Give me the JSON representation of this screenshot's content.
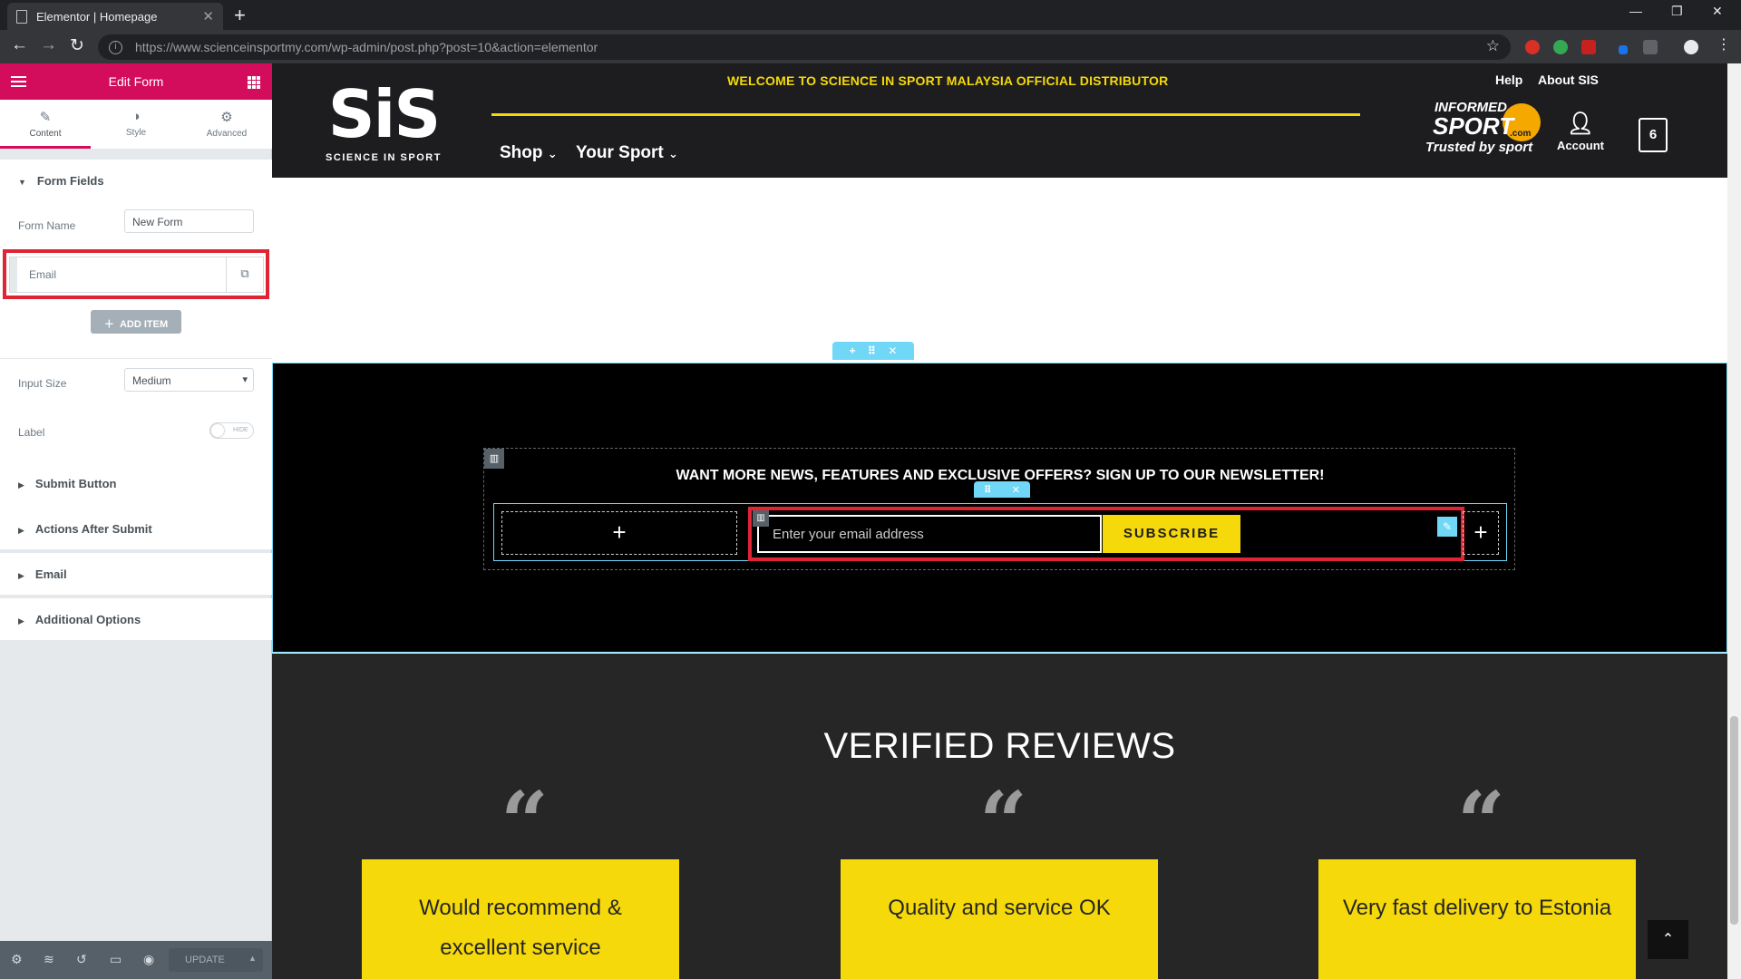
{
  "browser": {
    "tab_title": "Elementor | Homepage",
    "url": "https://www.scienceinsportmy.com/wp-admin/post.php?post=10&action=elementor"
  },
  "panel": {
    "header_title": "Edit Form",
    "tabs": [
      {
        "label": "Content",
        "icon": "pencil-icon"
      },
      {
        "label": "Style",
        "icon": "half-circle-icon"
      },
      {
        "label": "Advanced",
        "icon": "gear-icon"
      }
    ],
    "form_fields_title": "Form Fields",
    "form_name_label": "Form Name",
    "form_name_value": "New Form",
    "field_item_label": "Email",
    "add_item_label": "ADD ITEM",
    "input_size_label": "Input Size",
    "input_size_value": "Medium",
    "label_label": "Label",
    "label_toggle_text": "HIDE",
    "sections": [
      "Submit Button",
      "Actions After Submit",
      "Email",
      "Additional Options"
    ],
    "update_label": "UPDATE"
  },
  "site": {
    "welcome_text": "WELCOME TO SCIENCE IN SPORT MALAYSIA OFFICIAL DISTRIBUTOR",
    "help_link": "Help",
    "about_link": "About SIS",
    "logo_big": "SiS",
    "logo_small": "SCIENCE IN SPORT",
    "menu": [
      "Shop",
      "Your Sport"
    ],
    "informed_a": "INFORMED",
    "informed_b": "SPORT",
    "informed_com": ".com",
    "informed_c": "Trusted by sport",
    "account_label": "Account",
    "cart_count": "6",
    "newsletter_text_a": "WANT MORE NEWS, FEATURES AND EXCLUSIVE OFFERS?",
    "newsletter_text_b": "SIGN UP TO OUR NEWSLETTER!",
    "email_placeholder": "Enter your email address",
    "subscribe_label": "SUBSCRIBE",
    "reviews_title": "VERIFIED REVIEWS",
    "reviews": [
      "Would recommend & excellent service",
      "Quality and service OK",
      "Very fast delivery to Estonia"
    ]
  }
}
